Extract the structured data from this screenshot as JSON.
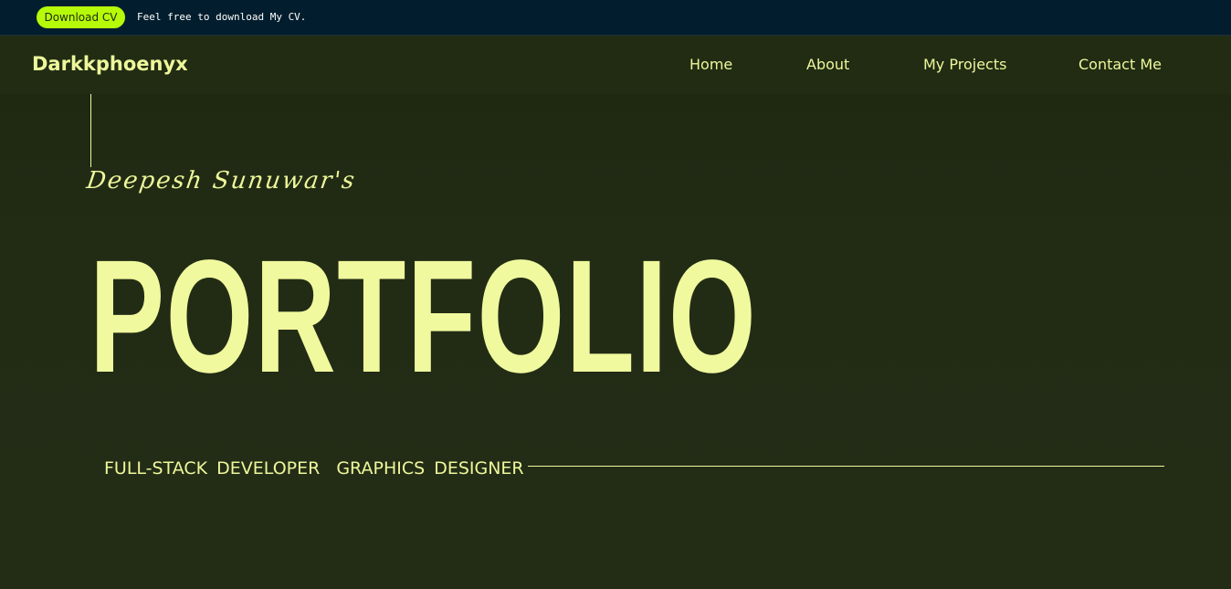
{
  "topbar": {
    "cv_button": "Download CV",
    "cv_note": "Feel free to download My CV."
  },
  "navbar": {
    "brand": "Darkkphoenyx",
    "items": [
      "Home",
      "About",
      "My Projects",
      "Contact Me"
    ]
  },
  "hero": {
    "subtitle": "Deepesh Sunuwar's",
    "title": "PORTFOLIO",
    "roles": [
      "FULL-STACK DEVELOPER",
      "GRAPHICS DESIGNER"
    ]
  },
  "colors": {
    "accent": "#eef79a",
    "button": "#b6fa0a",
    "topbar_bg": "#021e2e",
    "page_bg": "#222c15"
  }
}
